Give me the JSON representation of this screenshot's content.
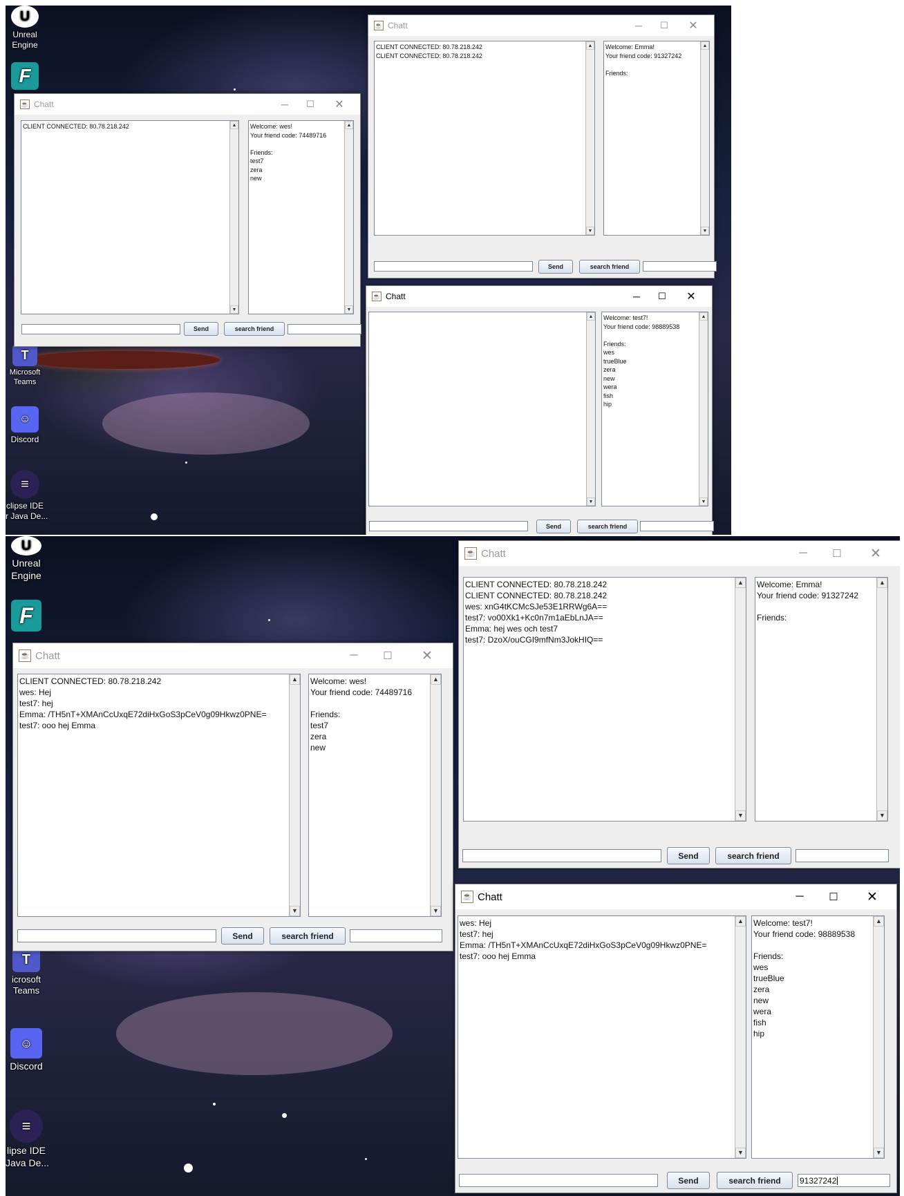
{
  "desktop_icons": {
    "unreal": "Unreal\nEngine",
    "teams": "Microsoft\nTeams",
    "teams_cut": "icrosoft\nTeams",
    "discord": "Discord",
    "eclipse": "clipse IDE\nr Java De...",
    "eclipse2": "lipse IDE\nJava De..."
  },
  "window_title": "Chatt",
  "send_label": "Send",
  "search_label": "search friend",
  "emma": {
    "welcome": "Welcome: Emma!\nYour friend code: 91327242\n\nFriends:",
    "chat_before": "CLIENT CONNECTED: 80.78.218.242\nCLIENT CONNECTED: 80.78.218.242",
    "chat_after": "CLIENT CONNECTED: 80.78.218.242\nCLIENT CONNECTED: 80.78.218.242\nwes: xnG4tKCMcSJe53E1RRWg6A==\ntest7: vo00Xk1+Kc0n7m1aEbLnJA==\nEmma: hej wes och test7\ntest7: DzoX/ouCGI9mfNm3JokHIQ=="
  },
  "wes": {
    "welcome": "Welcome: wes!\nYour friend code: 74489716\n\nFriends:\ntest7\nzera\nnew",
    "chat_before": "CLIENT CONNECTED: 80.78.218.242",
    "chat_after": "CLIENT CONNECTED: 80.78.218.242\nwes: Hej\ntest7: hej\nEmma: /TH5nT+XMAnCcUxqE72diHxGoS3pCeV0g09Hkwz0PNE=\ntest7: ooo hej Emma"
  },
  "test7": {
    "welcome": "Welcome: test7!\nYour friend code: 98889538\n\nFriends:\nwes\ntrueBlue\nzera\nnew\nwera\nfish\nhip",
    "chat_before": "",
    "chat_after": "wes: Hej\ntest7: hej\nEmma: /TH5nT+XMAnCcUxqE72diHxGoS3pCeV0g09Hkwz0PNE=\ntest7: ooo hej Emma",
    "search_value": "91327242"
  },
  "colors": {
    "window_bg": "#eeeeee",
    "titlebar": "#ffffff",
    "button_top": "#f6f9fd",
    "button_bottom": "#d7e2ee"
  }
}
